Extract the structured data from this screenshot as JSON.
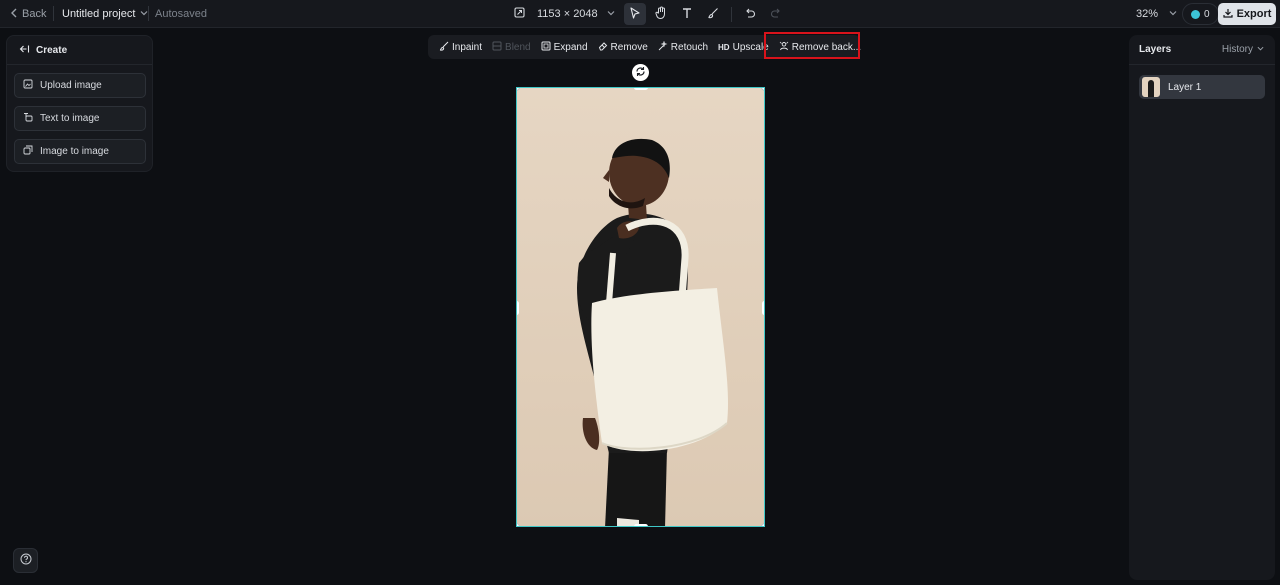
{
  "topbar": {
    "back_label": "Back",
    "project_title": "Untitled project",
    "autosaved": "Autosaved",
    "dimensions": "1153 × 2048",
    "zoom": "32%",
    "credits": "0",
    "export_label": "Export"
  },
  "actions": {
    "inpaint": "Inpaint",
    "blend": "Blend",
    "expand": "Expand",
    "remove": "Remove",
    "retouch": "Retouch",
    "hd": "HD",
    "upscale": "Upscale",
    "remove_background": "Remove back..."
  },
  "left_panel": {
    "header": "Create",
    "buttons": [
      "Upload image",
      "Text to image",
      "Image to image"
    ]
  },
  "right_panel": {
    "title": "Layers",
    "history": "History",
    "layers": [
      "Layer 1"
    ]
  },
  "colors": {
    "accent": "#3fc7c7",
    "highlight": "#d8131b",
    "background": "#0d0f13"
  }
}
